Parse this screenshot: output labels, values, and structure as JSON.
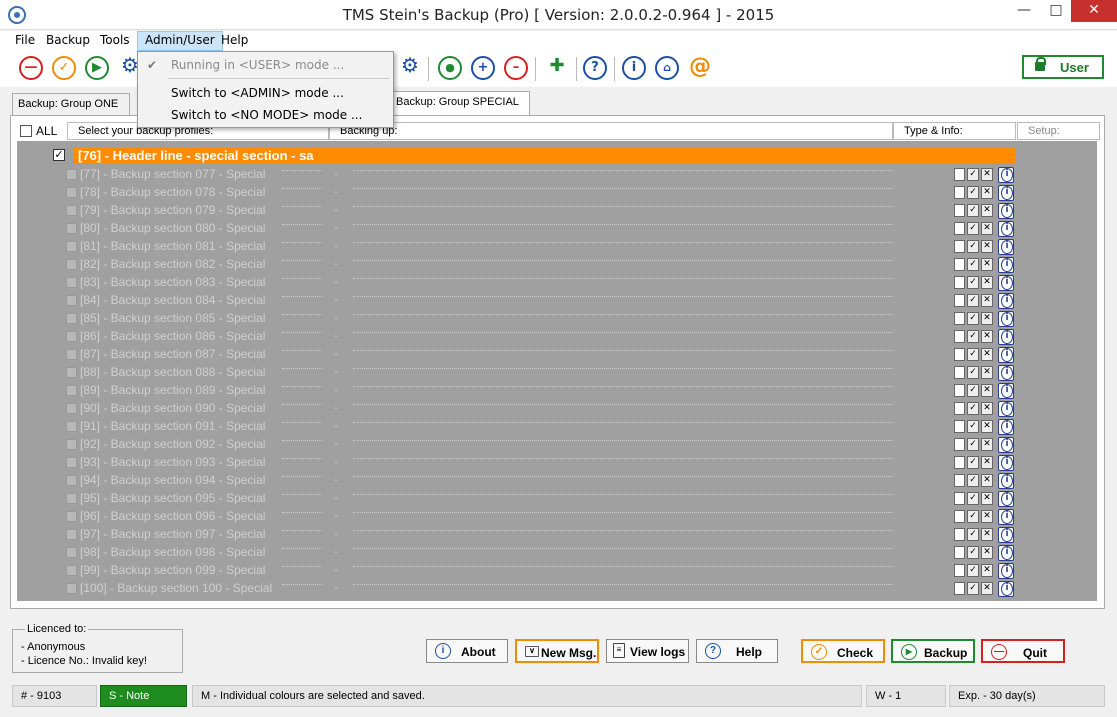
{
  "window": {
    "title": "TMS Stein's Backup (Pro) [ Version: 2.0.0.2-0.964 ] - 2015"
  },
  "menubar": {
    "items": [
      "File",
      "Backup",
      "Tools",
      "Admin/User",
      "Help"
    ]
  },
  "toolbar": {
    "user_label": "User"
  },
  "admin_menu": {
    "items": [
      {
        "label": "Running in <USER> mode ...",
        "checked": true,
        "disabled": true
      },
      {
        "label": "Switch to <ADMIN> mode ..."
      },
      {
        "label": "Switch to <NO MODE> mode ..."
      }
    ]
  },
  "tabs": [
    "Backup: Group ONE ...",
    "Backup: Group SPECIAL ..."
  ],
  "columns": {
    "all": "ALL",
    "profiles": "Select your backup profiles:",
    "backing_up": "Backing up:",
    "type_info": "Type & Info:",
    "setup": "Setup:"
  },
  "header_line": "[76] - Header line - special section - sa",
  "rows": [
    "[77] - Backup section 077 - Special",
    "[78] - Backup section 078 - Special",
    "[79] - Backup section 079 - Special",
    "[80] - Backup section 080 - Special",
    "[81] - Backup section 081 - Special",
    "[82] - Backup section 082 - Special",
    "[83] - Backup section 083 - Special",
    "[84] - Backup section 084 - Special",
    "[85] - Backup section 085 - Special",
    "[86] - Backup section 086 - Special",
    "[87] - Backup section 087 - Special",
    "[88] - Backup section 088 - Special",
    "[89] - Backup section 089 - Special",
    "[90] - Backup section 090 - Special",
    "[91] - Backup section 091 - Special",
    "[92] - Backup section 092 - Special",
    "[93] - Backup section 093 - Special",
    "[94] - Backup section 094 - Special",
    "[95] - Backup section 095 - Special",
    "[96] - Backup section 096 - Special",
    "[97] - Backup section 097 - Special",
    "[98] - Backup section 098 - Special",
    "[99] - Backup section 099 - Special",
    "[100] - Backup section 100 - Special"
  ],
  "row_dash": "-",
  "licence": {
    "title": "Licenced to:",
    "name": "- Anonymous",
    "number": "- Licence No.: Invalid key!"
  },
  "buttons": {
    "about": "About",
    "new_msg": "New Msg.",
    "view_logs": "View logs",
    "help": "Help",
    "check": "Check",
    "backup": "Backup",
    "quit": "Quit"
  },
  "status": {
    "number": "# - 9103",
    "note": "S - Note",
    "message": "M - Individual colours are selected and saved.",
    "w": "W - 1",
    "exp": "Exp. - 30 day(s)"
  },
  "colors": {
    "header_orange": "#ff8c00",
    "status_green": "#1e8c1e",
    "check_orange": "#f08c00",
    "backup_green": "#1f8a32",
    "quit_red": "#d42020"
  }
}
